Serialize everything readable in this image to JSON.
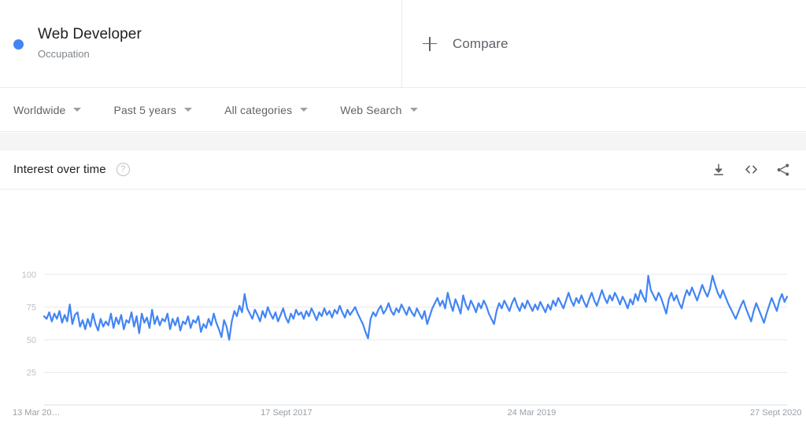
{
  "header": {
    "term": {
      "title": "Web Developer",
      "subtitle": "Occupation",
      "dot_color": "#4285f4"
    },
    "compare": {
      "label": "Compare",
      "icon": "plus-icon"
    }
  },
  "filters": [
    {
      "label": "Worldwide",
      "name": "location-filter"
    },
    {
      "label": "Past 5 years",
      "name": "time-range-filter"
    },
    {
      "label": "All categories",
      "name": "category-filter"
    },
    {
      "label": "Web Search",
      "name": "search-type-filter"
    }
  ],
  "card": {
    "title": "Interest over time",
    "help_icon_glyph": "?",
    "actions": [
      {
        "name": "download-icon",
        "title": "Download"
      },
      {
        "name": "embed-code-icon",
        "title": "Embed"
      },
      {
        "name": "share-icon",
        "title": "Share"
      }
    ]
  },
  "chart_data": {
    "type": "line",
    "title": "Interest over time",
    "xlabel": "",
    "ylabel": "",
    "ylim": [
      0,
      100
    ],
    "yticks": [
      25,
      50,
      75,
      100
    ],
    "grid": true,
    "legend": false,
    "line_color": "#4285f4",
    "line_width": 2.2,
    "xtick_labels": [
      "13 Mar 20…",
      "17 Sept 2017",
      "24 Mar 2019",
      "27 Sept 2020"
    ],
    "xtick_positions": [
      0,
      0.3339,
      0.6659,
      0.9926
    ],
    "series": [
      {
        "name": "Web Developer",
        "values": [
          68,
          66,
          71,
          64,
          70,
          66,
          72,
          63,
          69,
          64,
          77,
          62,
          69,
          71,
          60,
          65,
          58,
          66,
          60,
          70,
          62,
          57,
          66,
          60,
          64,
          61,
          70,
          59,
          67,
          62,
          69,
          58,
          65,
          63,
          71,
          60,
          68,
          55,
          70,
          63,
          67,
          59,
          73,
          62,
          68,
          61,
          66,
          64,
          70,
          58,
          66,
          61,
          67,
          57,
          64,
          62,
          68,
          59,
          65,
          63,
          68,
          56,
          62,
          59,
          66,
          61,
          70,
          63,
          58,
          52,
          65,
          60,
          50,
          64,
          72,
          68,
          76,
          71,
          85,
          74,
          70,
          66,
          73,
          69,
          64,
          72,
          67,
          75,
          70,
          66,
          71,
          64,
          69,
          74,
          67,
          63,
          70,
          66,
          73,
          69,
          71,
          66,
          72,
          68,
          74,
          70,
          65,
          71,
          68,
          74,
          69,
          72,
          67,
          73,
          70,
          76,
          71,
          67,
          73,
          69,
          72,
          75,
          70,
          66,
          62,
          56,
          51,
          66,
          71,
          68,
          73,
          76,
          70,
          73,
          78,
          72,
          69,
          74,
          71,
          77,
          73,
          69,
          75,
          71,
          68,
          74,
          70,
          66,
          72,
          62,
          68,
          74,
          78,
          82,
          76,
          80,
          74,
          86,
          78,
          72,
          81,
          76,
          70,
          84,
          77,
          73,
          80,
          76,
          71,
          78,
          74,
          80,
          76,
          70,
          66,
          62,
          72,
          78,
          74,
          80,
          76,
          72,
          78,
          82,
          76,
          72,
          78,
          74,
          80,
          76,
          72,
          77,
          73,
          79,
          75,
          71,
          77,
          73,
          80,
          76,
          82,
          78,
          74,
          80,
          86,
          80,
          76,
          82,
          78,
          84,
          79,
          75,
          81,
          86,
          80,
          76,
          82,
          88,
          82,
          78,
          84,
          80,
          86,
          82,
          77,
          83,
          79,
          74,
          81,
          77,
          85,
          80,
          88,
          83,
          79,
          99,
          88,
          84,
          80,
          86,
          82,
          76,
          70,
          81,
          86,
          80,
          84,
          78,
          74,
          82,
          88,
          84,
          90,
          85,
          80,
          86,
          92,
          87,
          83,
          89,
          99,
          92,
          86,
          82,
          88,
          83,
          78,
          74,
          70,
          66,
          71,
          76,
          80,
          74,
          69,
          64,
          72,
          78,
          73,
          68,
          63,
          70,
          76,
          82,
          77,
          72,
          80,
          85,
          79,
          83
        ]
      }
    ]
  }
}
